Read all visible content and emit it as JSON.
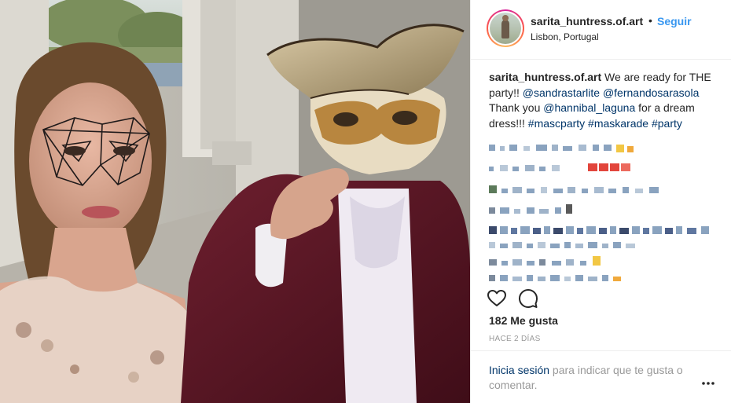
{
  "post": {
    "header": {
      "username": "sarita_huntress.of.art",
      "separator": "•",
      "follow_label": "Seguir",
      "location": "Lisbon, Portugal"
    },
    "caption": {
      "username": "sarita_huntress.of.art",
      "text_1": " We are ready for THE party!! ",
      "mention_1": "@sandrastarlite",
      "mention_2": "@fernandosarasola",
      "text_2": " Thank you ",
      "mention_3": "@hannibal_laguna",
      "text_3": " for a dream dress!!! ",
      "hashtag_1": "#mascparty",
      "hashtag_2": "#maskarade",
      "hashtag_3": "#party"
    },
    "likes_label": "182 Me gusta",
    "time_label": "HACE 2 DÍAS",
    "footer": {
      "login_link": "Inicia sesión",
      "login_rest": " para indicar que te gusta o comentar."
    },
    "icons": {
      "like": "heart-icon",
      "comment": "comment-icon",
      "more": "more-options-icon"
    },
    "colors": {
      "link": "#003569",
      "follow": "#3897f0",
      "muted": "#999999",
      "text": "#262626",
      "border": "#efefef"
    }
  }
}
